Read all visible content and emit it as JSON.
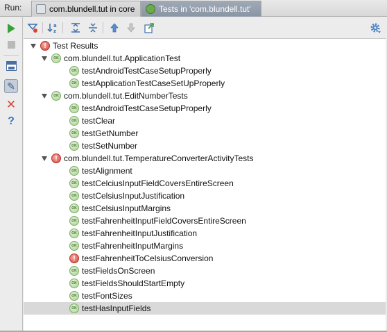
{
  "run_bar": {
    "label": "Run:",
    "tabs": [
      {
        "label": "com.blundell.tut in core",
        "active": false
      },
      {
        "label": "Tests in 'com.blundell.tut'",
        "active": true
      }
    ]
  },
  "left_toolbar": {
    "icons": [
      "rerun-icon",
      "stop-icon",
      "layout-icon",
      "pin-icon",
      "close-icon",
      "help-icon"
    ]
  },
  "top_toolbar": {
    "icons": [
      "hide-passed-icon",
      "sort-alpha-icon",
      "expand-all-icon",
      "collapse-all-icon",
      "previous-failed-icon",
      "next-failed-icon",
      "export-icon",
      "settings-icon"
    ]
  },
  "pass_badge": "OK",
  "fail_badge": "!",
  "colors": {
    "pass": "#6bab4c",
    "fail": "#d6473b",
    "selection": "#d9d9d9"
  },
  "tree": {
    "root": {
      "label": "Test Results",
      "status": "fail"
    },
    "suites": [
      {
        "label": "com.blundell.tut.ApplicationTest",
        "status": "pass",
        "tests": [
          {
            "label": "testAndroidTestCaseSetupProperly",
            "status": "pass"
          },
          {
            "label": "testApplicationTestCaseSetUpProperly",
            "status": "pass"
          }
        ]
      },
      {
        "label": "com.blundell.tut.EditNumberTests",
        "status": "pass",
        "tests": [
          {
            "label": "testAndroidTestCaseSetupProperly",
            "status": "pass"
          },
          {
            "label": "testClear",
            "status": "pass"
          },
          {
            "label": "testGetNumber",
            "status": "pass"
          },
          {
            "label": "testSetNumber",
            "status": "pass"
          }
        ]
      },
      {
        "label": "com.blundell.tut.TemperatureConverterActivityTests",
        "status": "fail",
        "tests": [
          {
            "label": "testAlignment",
            "status": "pass"
          },
          {
            "label": "testCelciusInputFieldCoversEntireScreen",
            "status": "pass"
          },
          {
            "label": "testCelsiusInputJustification",
            "status": "pass"
          },
          {
            "label": "testCelsiusInputMargins",
            "status": "pass"
          },
          {
            "label": "testFahrenheitInputFieldCoversEntireScreen",
            "status": "pass"
          },
          {
            "label": "testFahrenheitInputJustification",
            "status": "pass"
          },
          {
            "label": "testFahrenheitInputMargins",
            "status": "pass"
          },
          {
            "label": "testFahrenheitToCelsiusConversion",
            "status": "fail"
          },
          {
            "label": "testFieldsOnScreen",
            "status": "pass"
          },
          {
            "label": "testFieldsShouldStartEmpty",
            "status": "pass"
          },
          {
            "label": "testFontSizes",
            "status": "pass"
          },
          {
            "label": "testHasInputFields",
            "status": "pass",
            "selected": true
          }
        ]
      }
    ]
  }
}
